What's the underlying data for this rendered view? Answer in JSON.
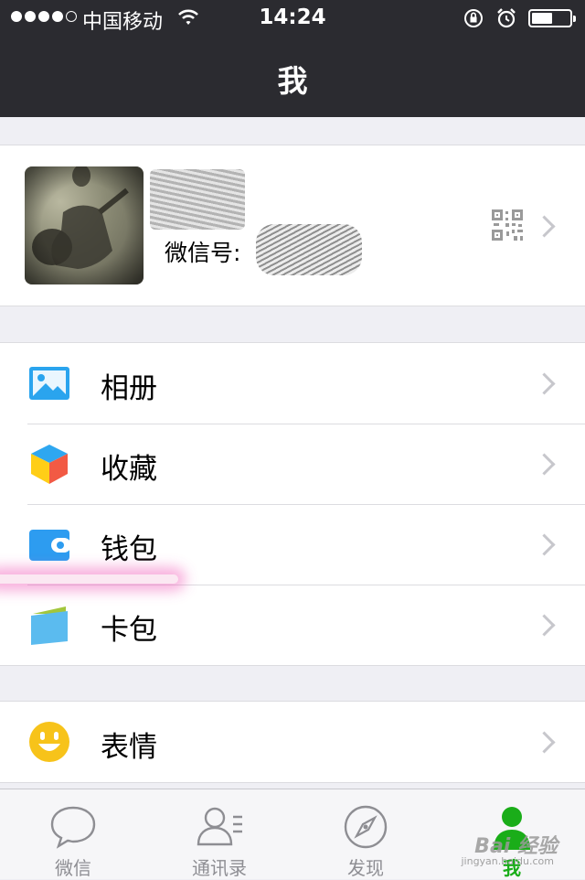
{
  "status_bar": {
    "carrier": "中国移动",
    "time": "14:24",
    "battery_level": 0.55
  },
  "nav": {
    "title": "我"
  },
  "profile": {
    "wechat_id_label": "微信号:"
  },
  "menu_groups": [
    [
      {
        "label": "相册",
        "icon": "photo-album-icon"
      },
      {
        "label": "收藏",
        "icon": "favorites-cube-icon"
      },
      {
        "label": "钱包",
        "icon": "wallet-icon"
      },
      {
        "label": "卡包",
        "icon": "card-pack-icon"
      }
    ],
    [
      {
        "label": "表情",
        "icon": "smiley-icon"
      }
    ]
  ],
  "tabs": [
    {
      "label": "微信",
      "icon": "chat-bubble-icon",
      "active": false
    },
    {
      "label": "通讯录",
      "icon": "contacts-icon",
      "active": false
    },
    {
      "label": "发现",
      "icon": "compass-icon",
      "active": false
    },
    {
      "label": "我",
      "icon": "me-person-icon",
      "active": true
    }
  ],
  "watermark": {
    "text": "Bai 经验",
    "subtext": "jingyan.baidu.com"
  },
  "colors": {
    "nav_background": "#2b2b30",
    "page_background": "#efeff4",
    "active_tab": "#1aad19",
    "inactive_tab": "#8e8e93",
    "highlight_marker": "#f050b4"
  }
}
